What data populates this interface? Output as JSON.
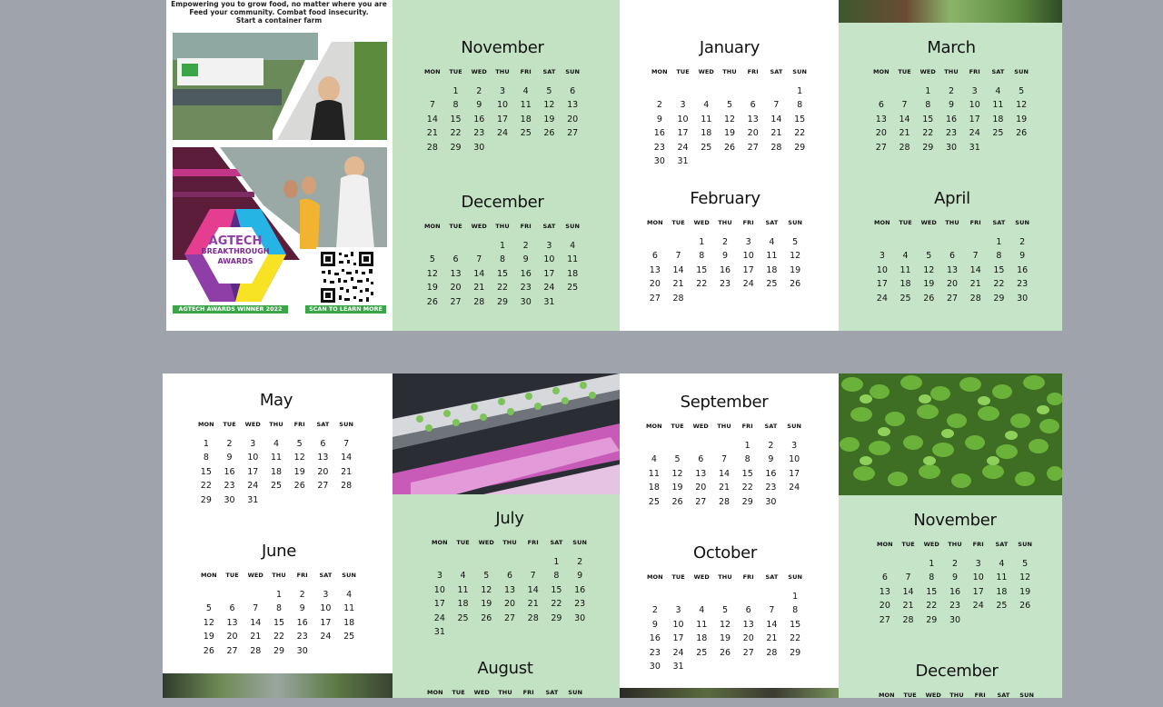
{
  "header": {
    "line1": "Empowering you to grow food, no matter where you are",
    "line2": "Feed your community. Combat food insecurity.",
    "line3": "Start a container farm"
  },
  "badges": {
    "agtech_line1": "AGTECH",
    "agtech_line2": "BREAKTHROUGH",
    "agtech_line3": "AWARDS",
    "winner_label": "AGTECH AWARDS WINNER 2022",
    "scan_label": "SCAN TO LEARN MORE"
  },
  "weekdays": [
    "MON",
    "TUE",
    "WED",
    "THU",
    "FRI",
    "SAT",
    "SUN"
  ],
  "months": {
    "november_top": {
      "name": "November",
      "offset": 1,
      "days": 30
    },
    "december_top": {
      "name": "December",
      "offset": 3,
      "days": 31
    },
    "january": {
      "name": "January",
      "offset": 6,
      "days": 31
    },
    "february": {
      "name": "February",
      "offset": 2,
      "days": 28
    },
    "march": {
      "name": "March",
      "offset": 2,
      "days": 31
    },
    "april": {
      "name": "April",
      "offset": 5,
      "days": 30
    },
    "may": {
      "name": "May",
      "offset": 0,
      "days": 31
    },
    "june": {
      "name": "June",
      "offset": 3,
      "days": 30
    },
    "july": {
      "name": "July",
      "offset": 5,
      "days": 31
    },
    "august": {
      "name": "August"
    },
    "september": {
      "name": "September",
      "offset": 4,
      "days": 30
    },
    "october": {
      "name": "October",
      "offset": 6,
      "days": 31
    },
    "november_bottom": {
      "name": "November",
      "offset": 2,
      "days": 30
    },
    "december_bottom": {
      "name": "December"
    }
  },
  "colors": {
    "background": "#9fa3ac",
    "panel_green": "#c3e2c3",
    "label_green": "#3aa648"
  }
}
